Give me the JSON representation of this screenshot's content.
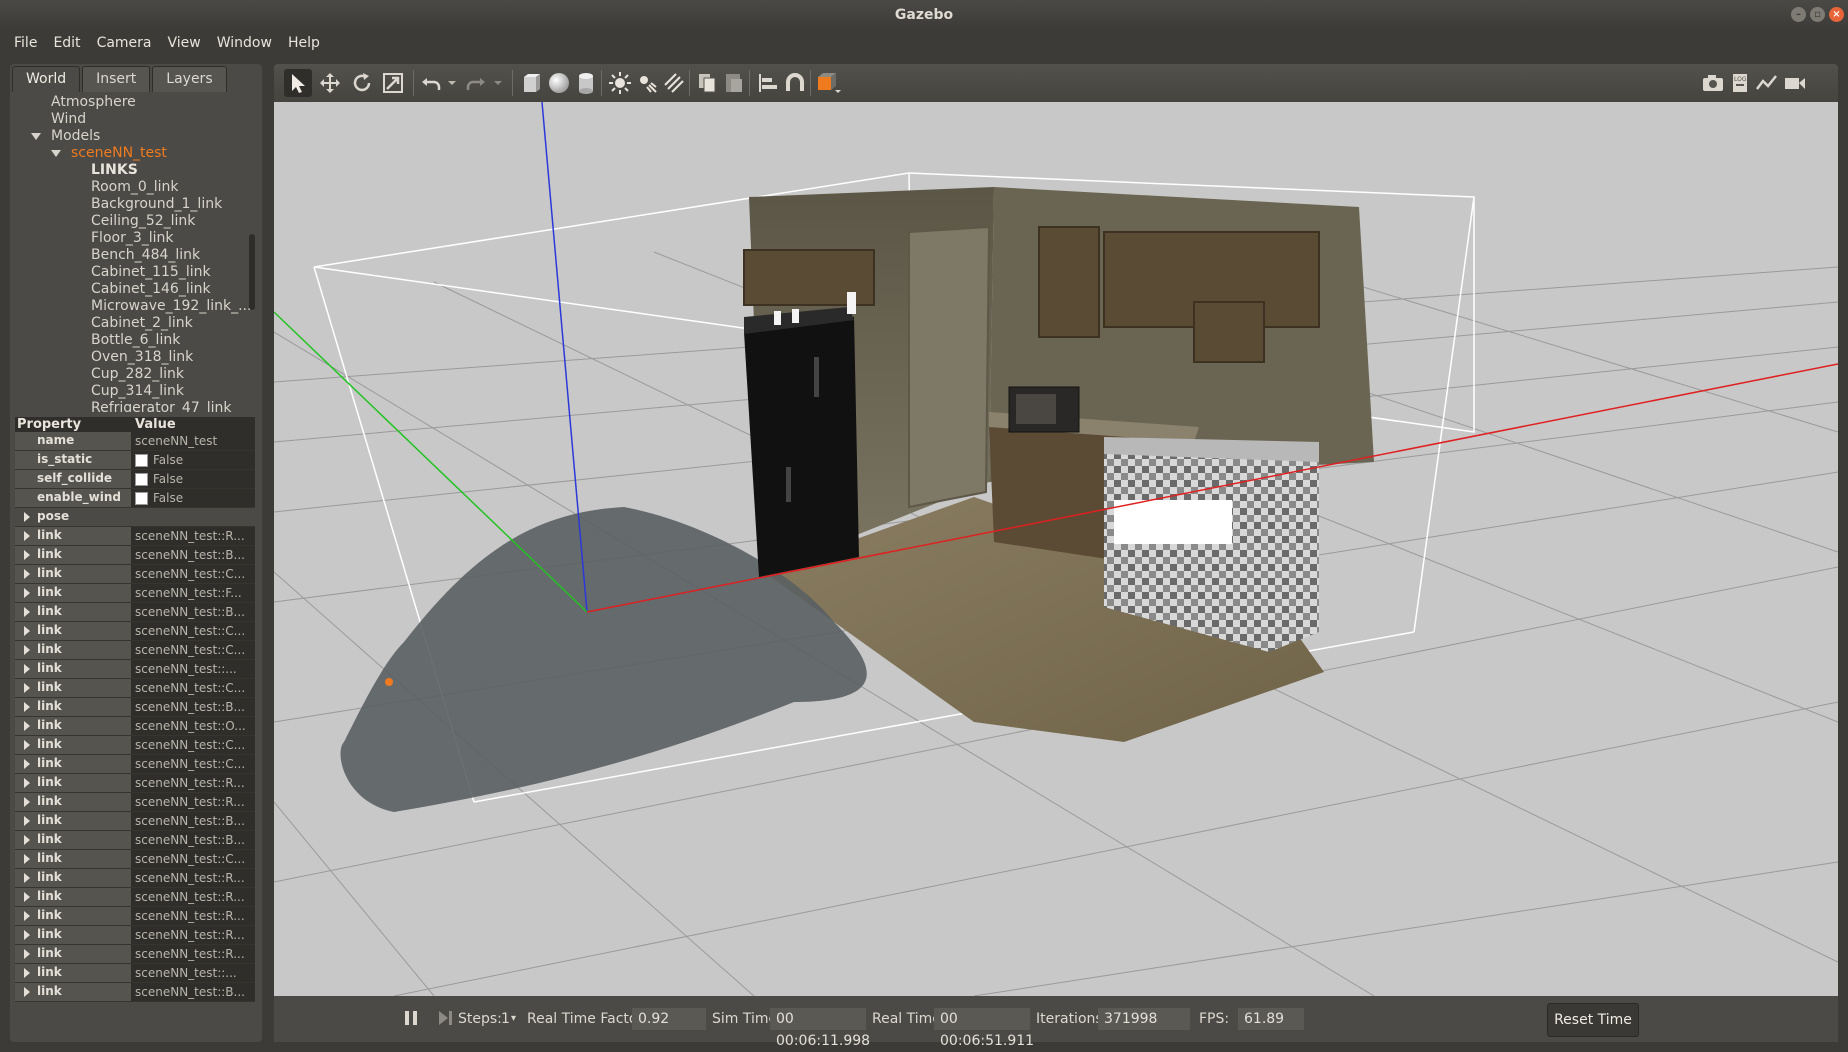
{
  "window": {
    "title": "Gazebo"
  },
  "menu": [
    "File",
    "Edit",
    "Camera",
    "View",
    "Window",
    "Help"
  ],
  "left_panel": {
    "tabs": [
      "World",
      "Insert",
      "Layers"
    ],
    "active_tab": "World",
    "tree": {
      "atmosphere": "Atmosphere",
      "wind": "Wind",
      "models": "Models",
      "model_name": "sceneNN_test",
      "links_header": "LINKS",
      "links": [
        "Room_0_link",
        "Background_1_link",
        "Ceiling_52_link",
        "Floor_3_link",
        "Bench_484_link",
        "Cabinet_115_link",
        "Cabinet_146_link",
        "Microwave_192_link_...",
        "Cabinet_2_link",
        "Bottle_6_link",
        "Oven_318_link",
        "Cup_282_link",
        "Cup_314_link",
        "Refrigerator_47_link"
      ]
    },
    "properties": {
      "header_property": "Property",
      "header_value": "Value",
      "name_key": "name",
      "name_value": "sceneNN_test",
      "is_static_key": "is_static",
      "is_static_value": "False",
      "self_collide_key": "self_collide",
      "self_collide_value": "False",
      "enable_wind_key": "enable_wind",
      "enable_wind_value": "False",
      "pose_key": "pose",
      "link_key": "link",
      "link_values": [
        "sceneNN_test::R...",
        "sceneNN_test::B...",
        "sceneNN_test::C...",
        "sceneNN_test::F...",
        "sceneNN_test::B...",
        "sceneNN_test::C...",
        "sceneNN_test::C...",
        "sceneNN_test::...",
        "sceneNN_test::C...",
        "sceneNN_test::B...",
        "sceneNN_test::O...",
        "sceneNN_test::C...",
        "sceneNN_test::C...",
        "sceneNN_test::R...",
        "sceneNN_test::R...",
        "sceneNN_test::B...",
        "sceneNN_test::B...",
        "sceneNN_test::C...",
        "sceneNN_test::R...",
        "sceneNN_test::R...",
        "sceneNN_test::R...",
        "sceneNN_test::R...",
        "sceneNN_test::R...",
        "sceneNN_test::...",
        "sceneNN_test::B..."
      ]
    }
  },
  "toolbar": {
    "left_icons": [
      "select-arrow-icon",
      "translate-icon",
      "rotate-icon",
      "scale-icon",
      "undo-icon",
      "undo-dropdown-icon",
      "redo-icon",
      "redo-dropdown-icon",
      "box-shape-icon",
      "sphere-shape-icon",
      "cylinder-shape-icon",
      "point-light-icon",
      "spot-light-icon",
      "directional-light-icon",
      "copy-icon",
      "paste-icon",
      "align-icon",
      "snap-magnet-icon",
      "view-angle-icon"
    ],
    "right_icons": [
      "screenshot-camera-icon",
      "log-icon",
      "plot-icon",
      "video-record-icon"
    ]
  },
  "bottom_bar": {
    "steps_label": "Steps:",
    "steps_value": "1",
    "rtf_label": "Real Time Factor:",
    "rtf_value": "0.92",
    "sim_time_label": "Sim Time:",
    "sim_time_value": "00 00:06:11.998",
    "real_time_label": "Real Time:",
    "real_time_value": "00 00:06:51.911",
    "iterations_label": "Iterations:",
    "iterations_value": "371998",
    "fps_label": "FPS:",
    "fps_value": "61.89",
    "reset_label": "Reset Time"
  },
  "colors": {
    "accent_orange": "#f07a1e",
    "panel_bg": "#4b4a46",
    "viewport_bg": "#c8c8c8"
  }
}
